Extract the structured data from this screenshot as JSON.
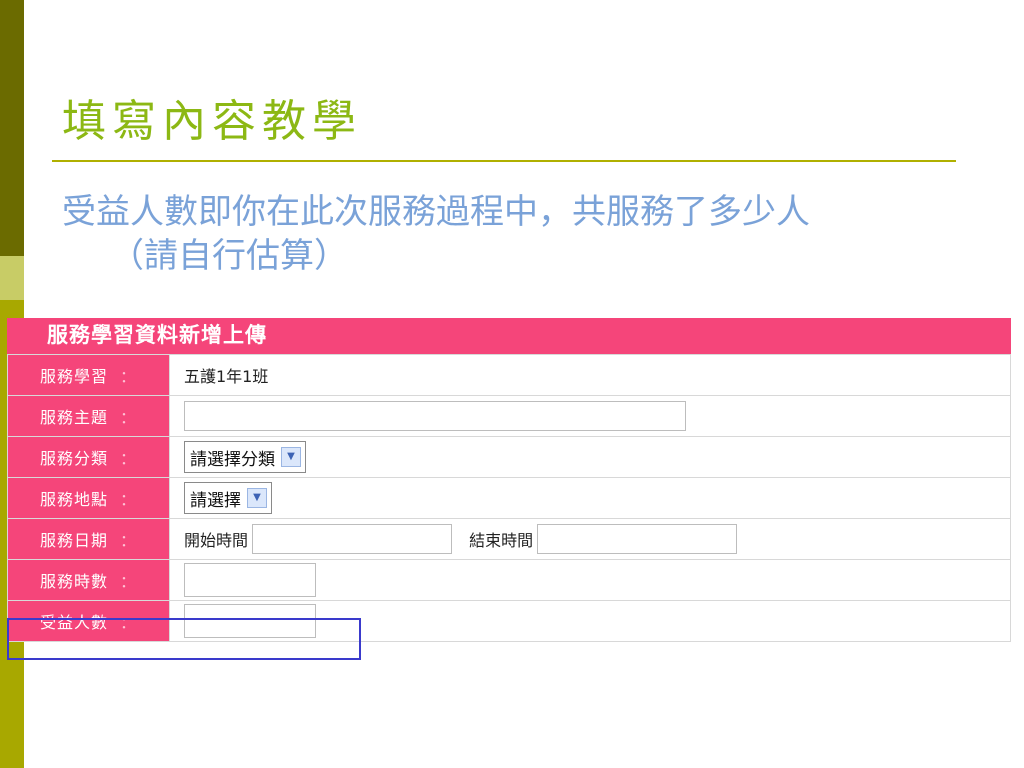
{
  "slide": {
    "title": "填寫內容教學",
    "desc_line1": "受益人數即你在此次服務過程中，共服務了多少人",
    "desc_line2": "（請自行估算）"
  },
  "form": {
    "header": "服務學習資料新增上傳",
    "colon": "：",
    "rows": {
      "learning": {
        "label": "服務學習",
        "value": "五護1年1班"
      },
      "topic": {
        "label": "服務主題",
        "value": ""
      },
      "category": {
        "label": "服務分類",
        "selected": "請選擇分類"
      },
      "location": {
        "label": "服務地點",
        "selected": "請選擇"
      },
      "date": {
        "label": "服務日期",
        "start_label": "開始時間",
        "start_value": "",
        "end_label": "結束時間",
        "end_value": ""
      },
      "hours": {
        "label": "服務時數",
        "value": ""
      },
      "beneficiaries": {
        "label": "受益人數",
        "value": ""
      }
    }
  },
  "colors": {
    "accent_pink": "#f5457a",
    "title_green": "#8cb814",
    "desc_blue": "#7aa2d8",
    "highlight_border": "#3a3acc"
  }
}
